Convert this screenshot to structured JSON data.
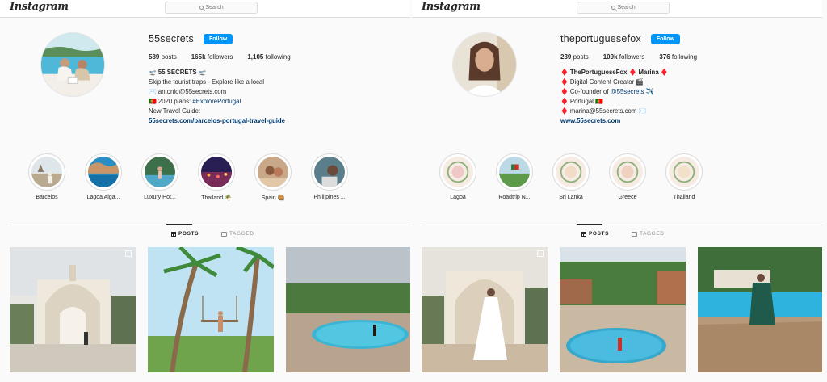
{
  "panels": [
    {
      "logo": "Instagram",
      "search_placeholder": "Search",
      "username": "55secrets",
      "follow_label": "Follow",
      "stats": {
        "posts": "589",
        "posts_label": "posts",
        "followers": "165k",
        "followers_label": "followers",
        "following": "1,105",
        "following_label": "following"
      },
      "bio": {
        "line1": "🛫 55 SECRETS 🛫",
        "line2": "Skip the tourist traps - Explore like a local",
        "line3": "✉️ antonio@55secrets.com",
        "line4_prefix": "🇵🇹 2020 plans: ",
        "line4_hashtag": "#ExplorePortugal",
        "line5": "New Travel Guide:",
        "link": "55secrets.com/barcelos-portugal-travel-guide"
      },
      "highlights": [
        "Barcelos",
        "Lagoa Alga...",
        "Luxury Hot...",
        "Thailand 🌴",
        "Spain 🥘",
        "Phillipines ..."
      ],
      "tabs": {
        "posts": "POSTS",
        "tagged": "TAGGED"
      }
    },
    {
      "logo": "Instagram",
      "search_placeholder": "Search",
      "username": "theportuguesefox",
      "follow_label": "Follow",
      "stats": {
        "posts": "239",
        "posts_label": "posts",
        "followers": "109k",
        "followers_label": "followers",
        "following": "376",
        "following_label": "following"
      },
      "bio": {
        "line1": "♦️ ThePortugueseFox ♦️ Marina ♦️",
        "line2": "♦️ Digital Content Creator 🎬",
        "line3_prefix": "♦️ Co-founder of ",
        "line3_mention": "@55secrets",
        "line3_suffix": " ✈️",
        "line4": "♦️ Portugal 🇵🇹",
        "line5": "♦️ marina@55secrets.com ✉️",
        "link": "www.55secrets.com"
      },
      "highlights": [
        "Lagoa",
        "Roadtrip N...",
        "Sri Lanka",
        "Greece",
        "Thailand"
      ],
      "tabs": {
        "posts": "POSTS",
        "tagged": "TAGGED"
      }
    }
  ],
  "colors": {
    "follow": "#0095f6",
    "link": "#00376b",
    "border": "#dbdbdb",
    "bg": "#fafafa"
  },
  "icons": [
    "search-icon",
    "grid-icon",
    "tag-icon",
    "multiple-posts-icon"
  ]
}
